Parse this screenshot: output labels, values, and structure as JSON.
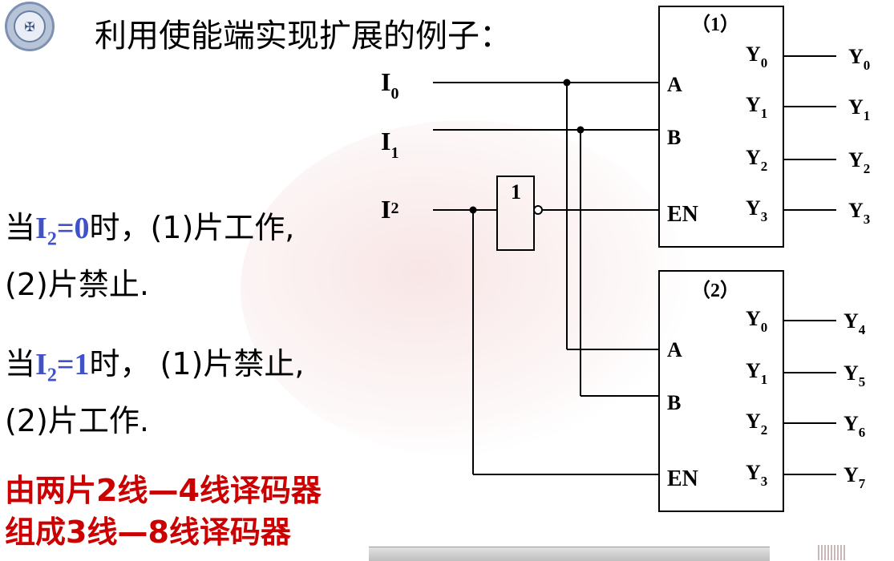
{
  "heading": "利用使能端实现扩展的例子：",
  "conditions": [
    {
      "prefix": "当",
      "signal": "I",
      "signal_sub": "2",
      "eq": "=",
      "value": "0",
      "line1_rest": "时，(1)片工作,",
      "line2": "(2)片禁止."
    },
    {
      "prefix": "当",
      "signal": "I",
      "signal_sub": "2",
      "eq": "=",
      "value": "1",
      "line1_rest": "时，  (1)片禁止,",
      "line2": "(2)片工作."
    }
  ],
  "summary": [
    "由两片2线—4线译码器",
    "组成3线—8线译码器"
  ],
  "diagram": {
    "inputs": [
      {
        "name": "I",
        "sub": "0"
      },
      {
        "name": "I",
        "sub": "1"
      },
      {
        "name": "I",
        "sub": "2"
      }
    ],
    "inverter_label": "1",
    "chips": [
      {
        "label": "（1）",
        "pins_in": [
          "A",
          "B",
          "EN"
        ],
        "pins_out": [
          {
            "n": "Y",
            "s": "0"
          },
          {
            "n": "Y",
            "s": "1"
          },
          {
            "n": "Y",
            "s": "2"
          },
          {
            "n": "Y",
            "s": "3"
          }
        ],
        "outputs": [
          {
            "n": "Y",
            "s": "0"
          },
          {
            "n": "Y",
            "s": "1"
          },
          {
            "n": "Y",
            "s": "2"
          },
          {
            "n": "Y",
            "s": "3"
          }
        ]
      },
      {
        "label": "（2）",
        "pins_in": [
          "A",
          "B",
          "EN"
        ],
        "pins_out": [
          {
            "n": "Y",
            "s": "0"
          },
          {
            "n": "Y",
            "s": "1"
          },
          {
            "n": "Y",
            "s": "2"
          },
          {
            "n": "Y",
            "s": "3"
          }
        ],
        "outputs": [
          {
            "n": "Y",
            "s": "4"
          },
          {
            "n": "Y",
            "s": "5"
          },
          {
            "n": "Y",
            "s": "6"
          },
          {
            "n": "Y",
            "s": "7"
          }
        ]
      }
    ]
  },
  "colors": {
    "highlight": "#3f52c8",
    "summary": "#cc0000"
  }
}
